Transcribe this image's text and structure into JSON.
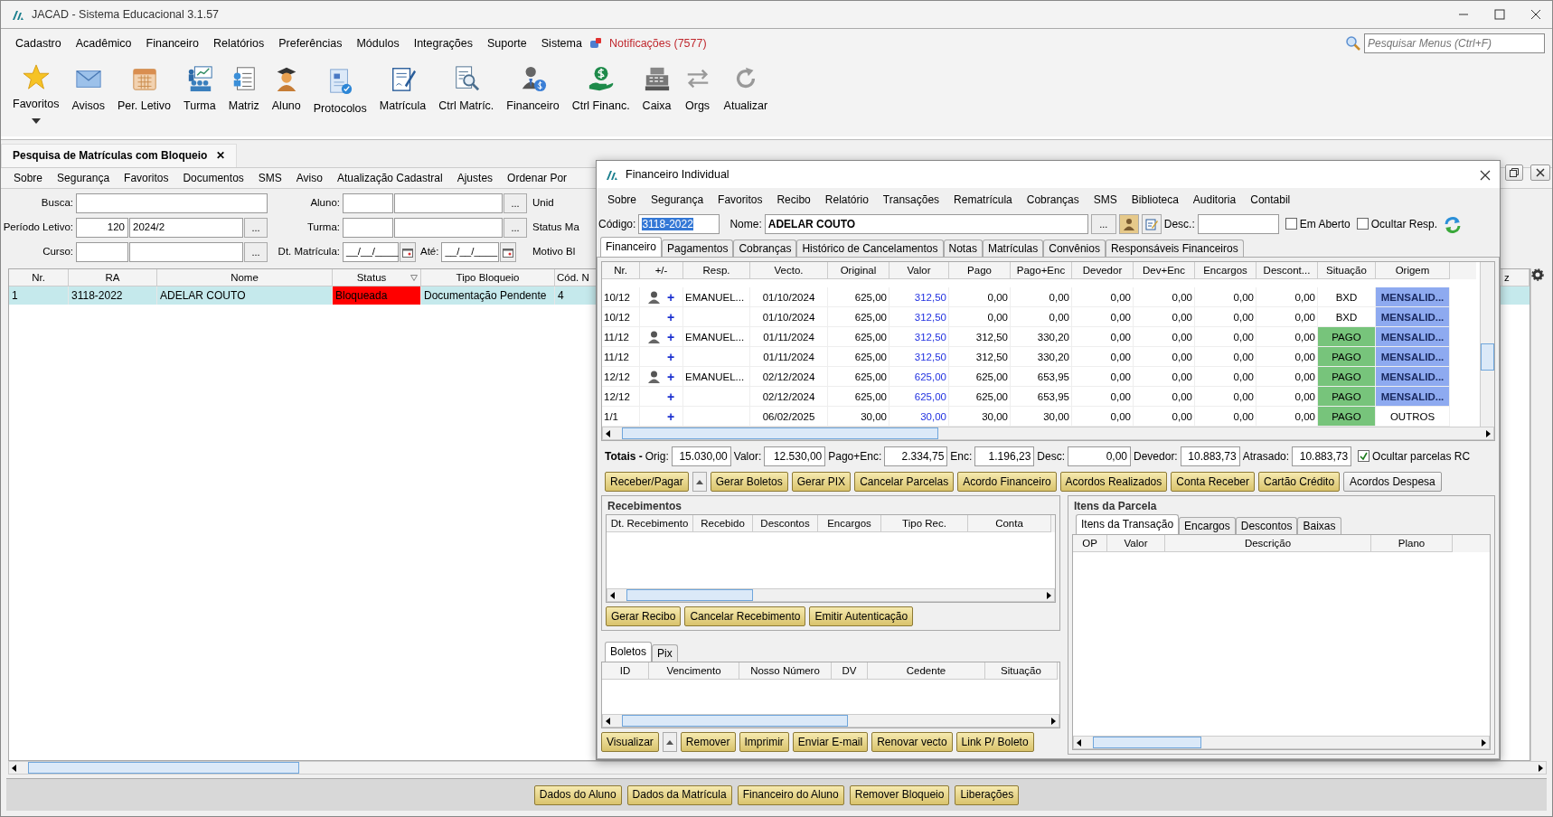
{
  "window": {
    "title": "JACAD - Sistema Educacional 3.1.57"
  },
  "menu": {
    "items": [
      "Cadastro",
      "Acadêmico",
      "Financeiro",
      "Relatórios",
      "Preferências",
      "Módulos",
      "Integrações",
      "Suporte",
      "Sistema"
    ],
    "notifications": "Notificações (7577)",
    "search": {
      "placeholder": "Pesquisar Menus (Ctrl+F)"
    }
  },
  "toolbar": [
    {
      "label": "Favoritos"
    },
    {
      "label": "Avisos"
    },
    {
      "label": "Per. Letivo"
    },
    {
      "label": "Turma"
    },
    {
      "label": "Matriz"
    },
    {
      "label": "Aluno"
    },
    {
      "label": "Protocolos"
    },
    {
      "label": "Matrícula"
    },
    {
      "label": "Ctrl Matríc."
    },
    {
      "label": "Financeiro"
    },
    {
      "label": "Ctrl Financ."
    },
    {
      "label": "Caixa"
    },
    {
      "label": "Orgs"
    },
    {
      "label": "Atualizar"
    }
  ],
  "document": {
    "tab": {
      "title": "Pesquisa de Matrículas com Bloqueio",
      "close": "✕"
    },
    "menu": [
      "Sobre",
      "Segurança",
      "Favoritos",
      "Documentos",
      "SMS",
      "Aviso",
      "Atualização Cadastral",
      "Ajustes",
      "Ordenar Por"
    ],
    "filters_left": [
      {
        "label": "Busca:",
        "kind": "single"
      },
      {
        "label": "Período Letivo:",
        "kind": "lookup",
        "code": "120",
        "value": "2024/2",
        "button": "..."
      },
      {
        "label": "Curso:",
        "kind": "lookup",
        "button": "..."
      }
    ],
    "filters_middle": [
      {
        "label": "Aluno:",
        "kind": "lookup",
        "button": "..."
      },
      {
        "label": "Turma:",
        "kind": "lookup",
        "button": "..."
      },
      {
        "label": "Dt. Matrícula:",
        "kind": "dates",
        "from": "__/__/____",
        "to_label": "Até:",
        "to": "__/__/____"
      }
    ],
    "filters_right": [
      "Unid",
      "Status Ma",
      "Motivo Bl"
    ],
    "grid": {
      "columns": [
        "Nr.",
        "RA",
        "Nome",
        "Status",
        "Tipo Bloqueio",
        "Cód. N"
      ],
      "right_column": "z",
      "rows": [
        {
          "selected": true,
          "cells": [
            {
              "text": "1"
            },
            {
              "text": "3118-2022"
            },
            {
              "text": "ADELAR COUTO"
            },
            {
              "text": "Bloqueada",
              "color": "#ff0000"
            },
            {
              "text": "Documentação Pendente"
            },
            {
              "text": "4"
            }
          ]
        }
      ]
    },
    "actions": [
      "Dados do Aluno",
      "Dados da Matrícula",
      "Financeiro do Aluno",
      "Remover Bloqueio",
      "Liberações"
    ]
  },
  "financeiro": {
    "title": "Financeiro Individual",
    "menu": [
      "Sobre",
      "Segurança",
      "Favoritos",
      "Recibo",
      "Relatório",
      "Transações",
      "Rematrícula",
      "Cobranças",
      "SMS",
      "Biblioteca",
      "Auditoria",
      "Contabil"
    ],
    "codigo": {
      "label": "Código:",
      "value": "3118-2022",
      "selected": true
    },
    "nome": {
      "label": "Nome:",
      "value": "ADELAR COUTO",
      "button": "..."
    },
    "desc": {
      "label": "Desc.:"
    },
    "checks": [
      {
        "label": "Em Aberto",
        "checked": false
      },
      {
        "label": "Ocultar Resp.",
        "checked": false
      }
    ],
    "tabs": [
      {
        "label": "Financeiro",
        "selected": true
      },
      {
        "label": "Pagamentos",
        "selected": false
      },
      {
        "label": "Cobranças",
        "selected": false
      },
      {
        "label": "Histórico de Cancelamentos",
        "selected": false
      },
      {
        "label": "Notas",
        "selected": false
      },
      {
        "label": "Matrículas",
        "selected": false
      },
      {
        "label": "Convênios",
        "selected": false
      },
      {
        "label": "Responsáveis Financeiros",
        "selected": false
      }
    ],
    "parcelas": {
      "columns": [
        "Nr.",
        "+/-",
        "Resp.",
        "Vecto.",
        "Original",
        "Valor",
        "Pago",
        "Pago+Enc",
        "Devedor",
        "Dev+Enc",
        "Encargos",
        "Descont...",
        "Situação",
        "Origem"
      ],
      "rows": [
        {
          "nr": "10/12",
          "resp_icon": true,
          "toggle": "+",
          "resp": "EMANUEL...",
          "vecto": "01/10/2024",
          "values": [
            "625,00",
            "312,50",
            "0,00",
            "0,00",
            "0,00",
            "0,00",
            "0,00",
            "0,00"
          ],
          "situacao": {
            "text": "BXD"
          },
          "origem": {
            "text": "MENSALID...",
            "color": "#8eaaf0"
          }
        },
        {
          "nr": "10/12",
          "resp_icon": false,
          "toggle": "+",
          "vecto": "01/10/2024",
          "values": [
            "625,00",
            "312,50",
            "0,00",
            "0,00",
            "0,00",
            "0,00",
            "0,00",
            "0,00"
          ],
          "situacao": {
            "text": "BXD"
          },
          "origem": {
            "text": "MENSALID...",
            "color": "#8eaaf0"
          }
        },
        {
          "nr": "11/12",
          "resp_icon": true,
          "toggle": "+",
          "resp": "EMANUEL...",
          "vecto": "01/11/2024",
          "values": [
            "625,00",
            "312,50",
            "312,50",
            "330,20",
            "0,00",
            "0,00",
            "0,00",
            "0,00"
          ],
          "situacao": {
            "text": "PAGO",
            "color": "#77c47b"
          },
          "origem": {
            "text": "MENSALID...",
            "color": "#8eaaf0"
          }
        },
        {
          "nr": "11/12",
          "resp_icon": false,
          "toggle": "+",
          "vecto": "01/11/2024",
          "values": [
            "625,00",
            "312,50",
            "312,50",
            "330,20",
            "0,00",
            "0,00",
            "0,00",
            "0,00"
          ],
          "situacao": {
            "text": "PAGO",
            "color": "#77c47b"
          },
          "origem": {
            "text": "MENSALID...",
            "color": "#8eaaf0"
          }
        },
        {
          "nr": "12/12",
          "resp_icon": true,
          "toggle": "+",
          "resp": "EMANUEL...",
          "vecto": "02/12/2024",
          "values": [
            "625,00",
            "625,00",
            "625,00",
            "653,95",
            "0,00",
            "0,00",
            "0,00",
            "0,00"
          ],
          "situacao": {
            "text": "PAGO",
            "color": "#77c47b"
          },
          "origem": {
            "text": "MENSALID...",
            "color": "#8eaaf0"
          }
        },
        {
          "nr": "12/12",
          "resp_icon": false,
          "toggle": "+",
          "vecto": "02/12/2024",
          "values": [
            "625,00",
            "625,00",
            "625,00",
            "653,95",
            "0,00",
            "0,00",
            "0,00",
            "0,00"
          ],
          "situacao": {
            "text": "PAGO",
            "color": "#77c47b"
          },
          "origem": {
            "text": "MENSALID...",
            "color": "#8eaaf0"
          }
        },
        {
          "nr": "1/1",
          "resp_icon": false,
          "toggle": "+",
          "vecto": "06/02/2025",
          "values": [
            "30,00",
            "30,00",
            "30,00",
            "30,00",
            "0,00",
            "0,00",
            "0,00",
            "0,00"
          ],
          "situacao": {
            "text": "PAGO",
            "color": "#77c47b"
          },
          "origem": {
            "text": "OUTROS"
          }
        }
      ]
    },
    "totals": {
      "title": "Totais -",
      "fields": [
        {
          "label": "Orig:",
          "value": "15.030,00"
        },
        {
          "label": "Valor:",
          "value": "12.530,00"
        },
        {
          "label": "Pago+Enc:",
          "value": "2.334,75"
        },
        {
          "label": "Enc:",
          "value": "1.196,23"
        },
        {
          "label": "Desc:",
          "value": "0,00"
        },
        {
          "label": "Devedor:",
          "value": "10.883,73"
        },
        {
          "label": "Atrasado:",
          "value": "10.883,73"
        }
      ],
      "hide_rc": {
        "label": "Ocultar parcelas RC",
        "checked": true
      }
    },
    "buttons": [
      {
        "label": "Receber/Pagar",
        "kind": "action"
      },
      {
        "kind": "arrow"
      },
      {
        "label": "Gerar Boletos",
        "kind": "action"
      },
      {
        "label": "Gerar PIX",
        "kind": "action"
      },
      {
        "label": "Cancelar Parcelas",
        "kind": "action"
      },
      {
        "label": "Acordo Financeiro",
        "kind": "action"
      },
      {
        "label": "Acordos Realizados",
        "kind": "action"
      },
      {
        "label": "Conta Receber",
        "kind": "action"
      },
      {
        "label": "Cartão Crédito",
        "kind": "action"
      },
      {
        "label": "Acordos Despesa",
        "kind": "plain"
      }
    ],
    "recebimentos": {
      "title": "Recebimentos",
      "columns": [
        "Dt. Recebimento",
        "Recebido",
        "Descontos",
        "Encargos",
        "Tipo Rec.",
        "Conta"
      ],
      "buttons": [
        {
          "label": "Gerar Recibo",
          "kind": "action"
        },
        {
          "label": "Cancelar Recebimento",
          "kind": "action"
        },
        {
          "label": "Emitir Autenticação",
          "kind": "action"
        }
      ]
    },
    "boletos": {
      "tabs": [
        {
          "label": "Boletos",
          "selected": true
        },
        {
          "label": "Pix",
          "selected": false
        }
      ],
      "columns": [
        "ID",
        "Vencimento",
        "Nosso Número",
        "DV",
        "Cedente",
        "Situação"
      ],
      "buttons": [
        {
          "label": "Visualizar",
          "kind": "action"
        },
        {
          "kind": "arrow"
        },
        {
          "label": "Remover",
          "kind": "action"
        },
        {
          "label": "Imprimir",
          "kind": "action"
        },
        {
          "label": "Enviar E-mail",
          "kind": "action"
        },
        {
          "label": "Renovar vecto",
          "kind": "action"
        },
        {
          "label": "Link P/ Boleto",
          "kind": "action"
        }
      ]
    },
    "itens": {
      "title": "Itens da Parcela",
      "tabs": [
        {
          "label": "Itens da Transação",
          "selected": true
        },
        {
          "label": "Encargos",
          "selected": false
        },
        {
          "label": "Descontos",
          "selected": false
        },
        {
          "label": "Baixas",
          "selected": false
        }
      ],
      "columns": [
        "OP",
        "Valor",
        "Descrição",
        "Plano"
      ]
    }
  }
}
